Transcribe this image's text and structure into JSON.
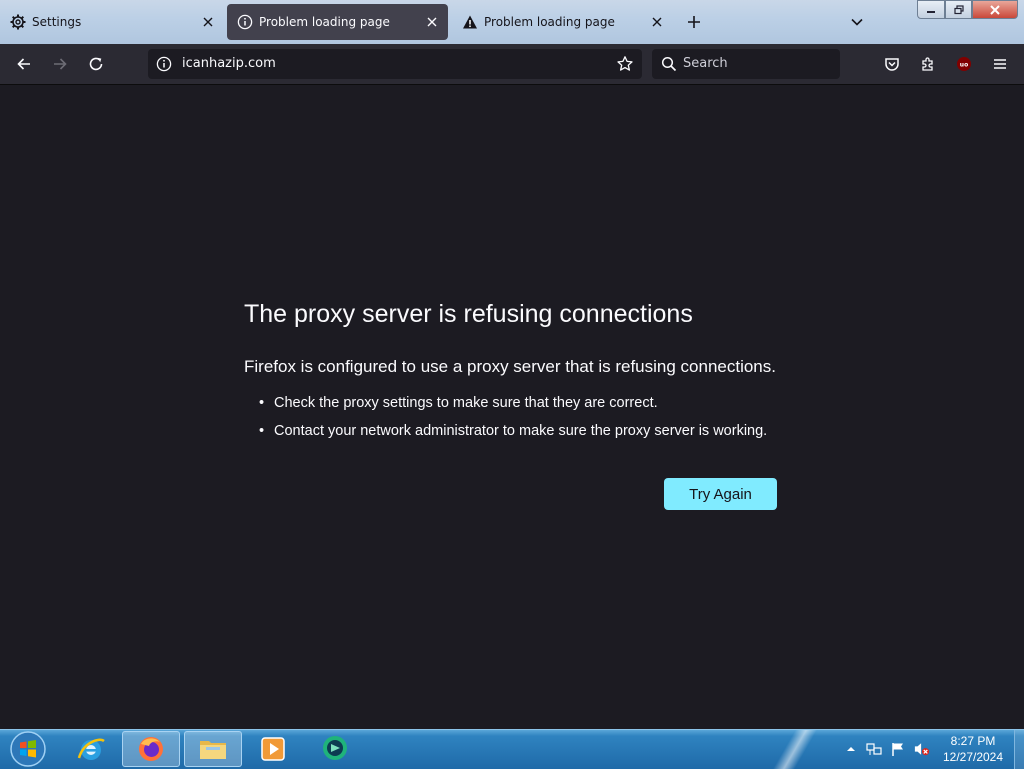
{
  "tabs": [
    {
      "label": "Settings",
      "icon": "gear-icon",
      "active": false
    },
    {
      "label": "Problem loading page",
      "icon": "info-icon",
      "active": true
    },
    {
      "label": "Problem loading page",
      "icon": "warning-icon",
      "active": false
    }
  ],
  "navbar": {
    "url": "icanhazip.com",
    "search_placeholder": "Search"
  },
  "error": {
    "title": "The proxy server is refusing connections",
    "description": "Firefox is configured to use a proxy server that is refusing connections.",
    "suggestions": [
      "Check the proxy settings to make sure that they are correct.",
      "Contact your network administrator to make sure the proxy server is working."
    ],
    "try_again_label": "Try Again"
  },
  "taskbar": {
    "time": "8:27 PM",
    "date": "12/27/2024"
  },
  "colors": {
    "accent": "#80ebff",
    "page_bg": "#1c1b22",
    "toolbar_bg": "#2b2a33",
    "taskbar": "#1f6aa8"
  }
}
